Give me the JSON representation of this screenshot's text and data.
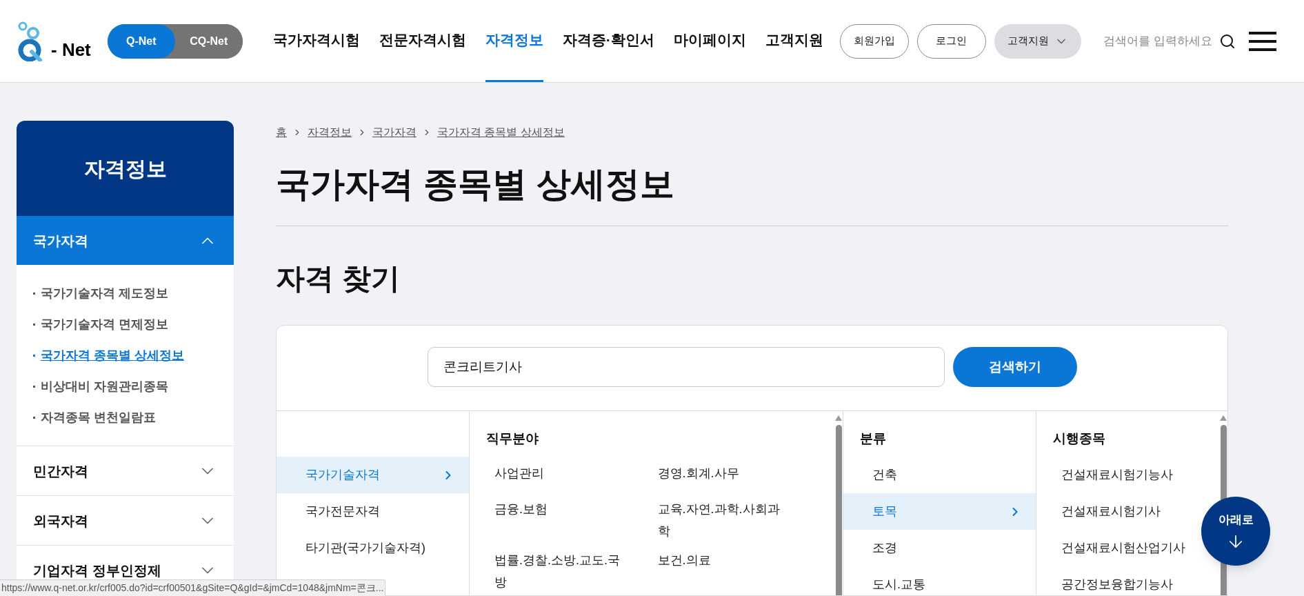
{
  "header": {
    "logo_text": "- Net",
    "site_toggle": [
      {
        "label": "Q-Net",
        "selected": true
      },
      {
        "label": "CQ-Net",
        "selected": false
      }
    ],
    "nav": [
      {
        "label": "국가자격시험",
        "selected": false
      },
      {
        "label": "전문자격시험",
        "selected": false
      },
      {
        "label": "자격정보",
        "selected": true
      },
      {
        "label": "자격증·확인서",
        "selected": false
      },
      {
        "label": "마이페이지",
        "selected": false
      },
      {
        "label": "고객지원",
        "selected": false
      }
    ],
    "buttons": [
      "회원가입",
      "로그인"
    ],
    "support_dropdown": "고객지원",
    "search": {
      "placeholder": "검색어를 입력하세요"
    }
  },
  "sidebar": {
    "title": "자격정보",
    "sections": [
      {
        "label": "국가자격",
        "expanded": true,
        "children": [
          {
            "label": "국가기술자격 제도정보",
            "selected": false
          },
          {
            "label": "국가기술자격 면제정보",
            "selected": false
          },
          {
            "label": "국가자격 종목별 상세정보",
            "selected": true
          },
          {
            "label": "비상대비 자원관리종목",
            "selected": false
          },
          {
            "label": "자격종목 변천일람표",
            "selected": false
          }
        ]
      },
      {
        "label": "민간자격",
        "expanded": false
      },
      {
        "label": "외국자격",
        "expanded": false
      },
      {
        "label": "기업자격 정부인정제",
        "expanded": false
      }
    ]
  },
  "breadcrumb": [
    "홈",
    "자격정보",
    "국가자격",
    "국가자격 종목별 상세정보"
  ],
  "page_title": "국가자격 종목별 상세정보",
  "section_title": "자격 찾기",
  "search": {
    "value": "콘크리트기사",
    "button": "검색하기"
  },
  "columns": [
    {
      "items": [
        {
          "label": "국가기술자격",
          "selected": true
        },
        {
          "label": "국가전문자격",
          "selected": false
        },
        {
          "label": "타기관(국가기술자격)",
          "selected": false
        }
      ]
    },
    {
      "heading": "직무분야",
      "items": [
        {
          "label": "사업관리",
          "selected": false
        },
        {
          "label": "경영.회계.사무",
          "selected": false
        },
        {
          "label": "금융.보험",
          "selected": false
        },
        {
          "label": "교육.자연.과학.사회과학",
          "selected": false
        },
        {
          "label": "법률.경찰.소방.교도.국방",
          "selected": false
        },
        {
          "label": "보건.의료",
          "selected": false
        }
      ]
    },
    {
      "heading": "분류",
      "items": [
        {
          "label": "건축",
          "selected": false
        },
        {
          "label": "토목",
          "selected": true
        },
        {
          "label": "조경",
          "selected": false
        },
        {
          "label": "도시.교통",
          "selected": false
        }
      ]
    },
    {
      "heading": "시행종목",
      "items": [
        {
          "label": "건설재료시험기능사",
          "selected": false
        },
        {
          "label": "건설재료시험기사",
          "selected": false
        },
        {
          "label": "건설재료시험산업기사",
          "selected": false
        },
        {
          "label": "공간정보융합기능사",
          "selected": false
        }
      ]
    }
  ],
  "floating_button": "아래로",
  "status_url": "https://www.q-net.or.kr/crf005.do?id=crf00501&gSite=Q&gId=&jmCd=1048&jmNm=콘크..."
}
